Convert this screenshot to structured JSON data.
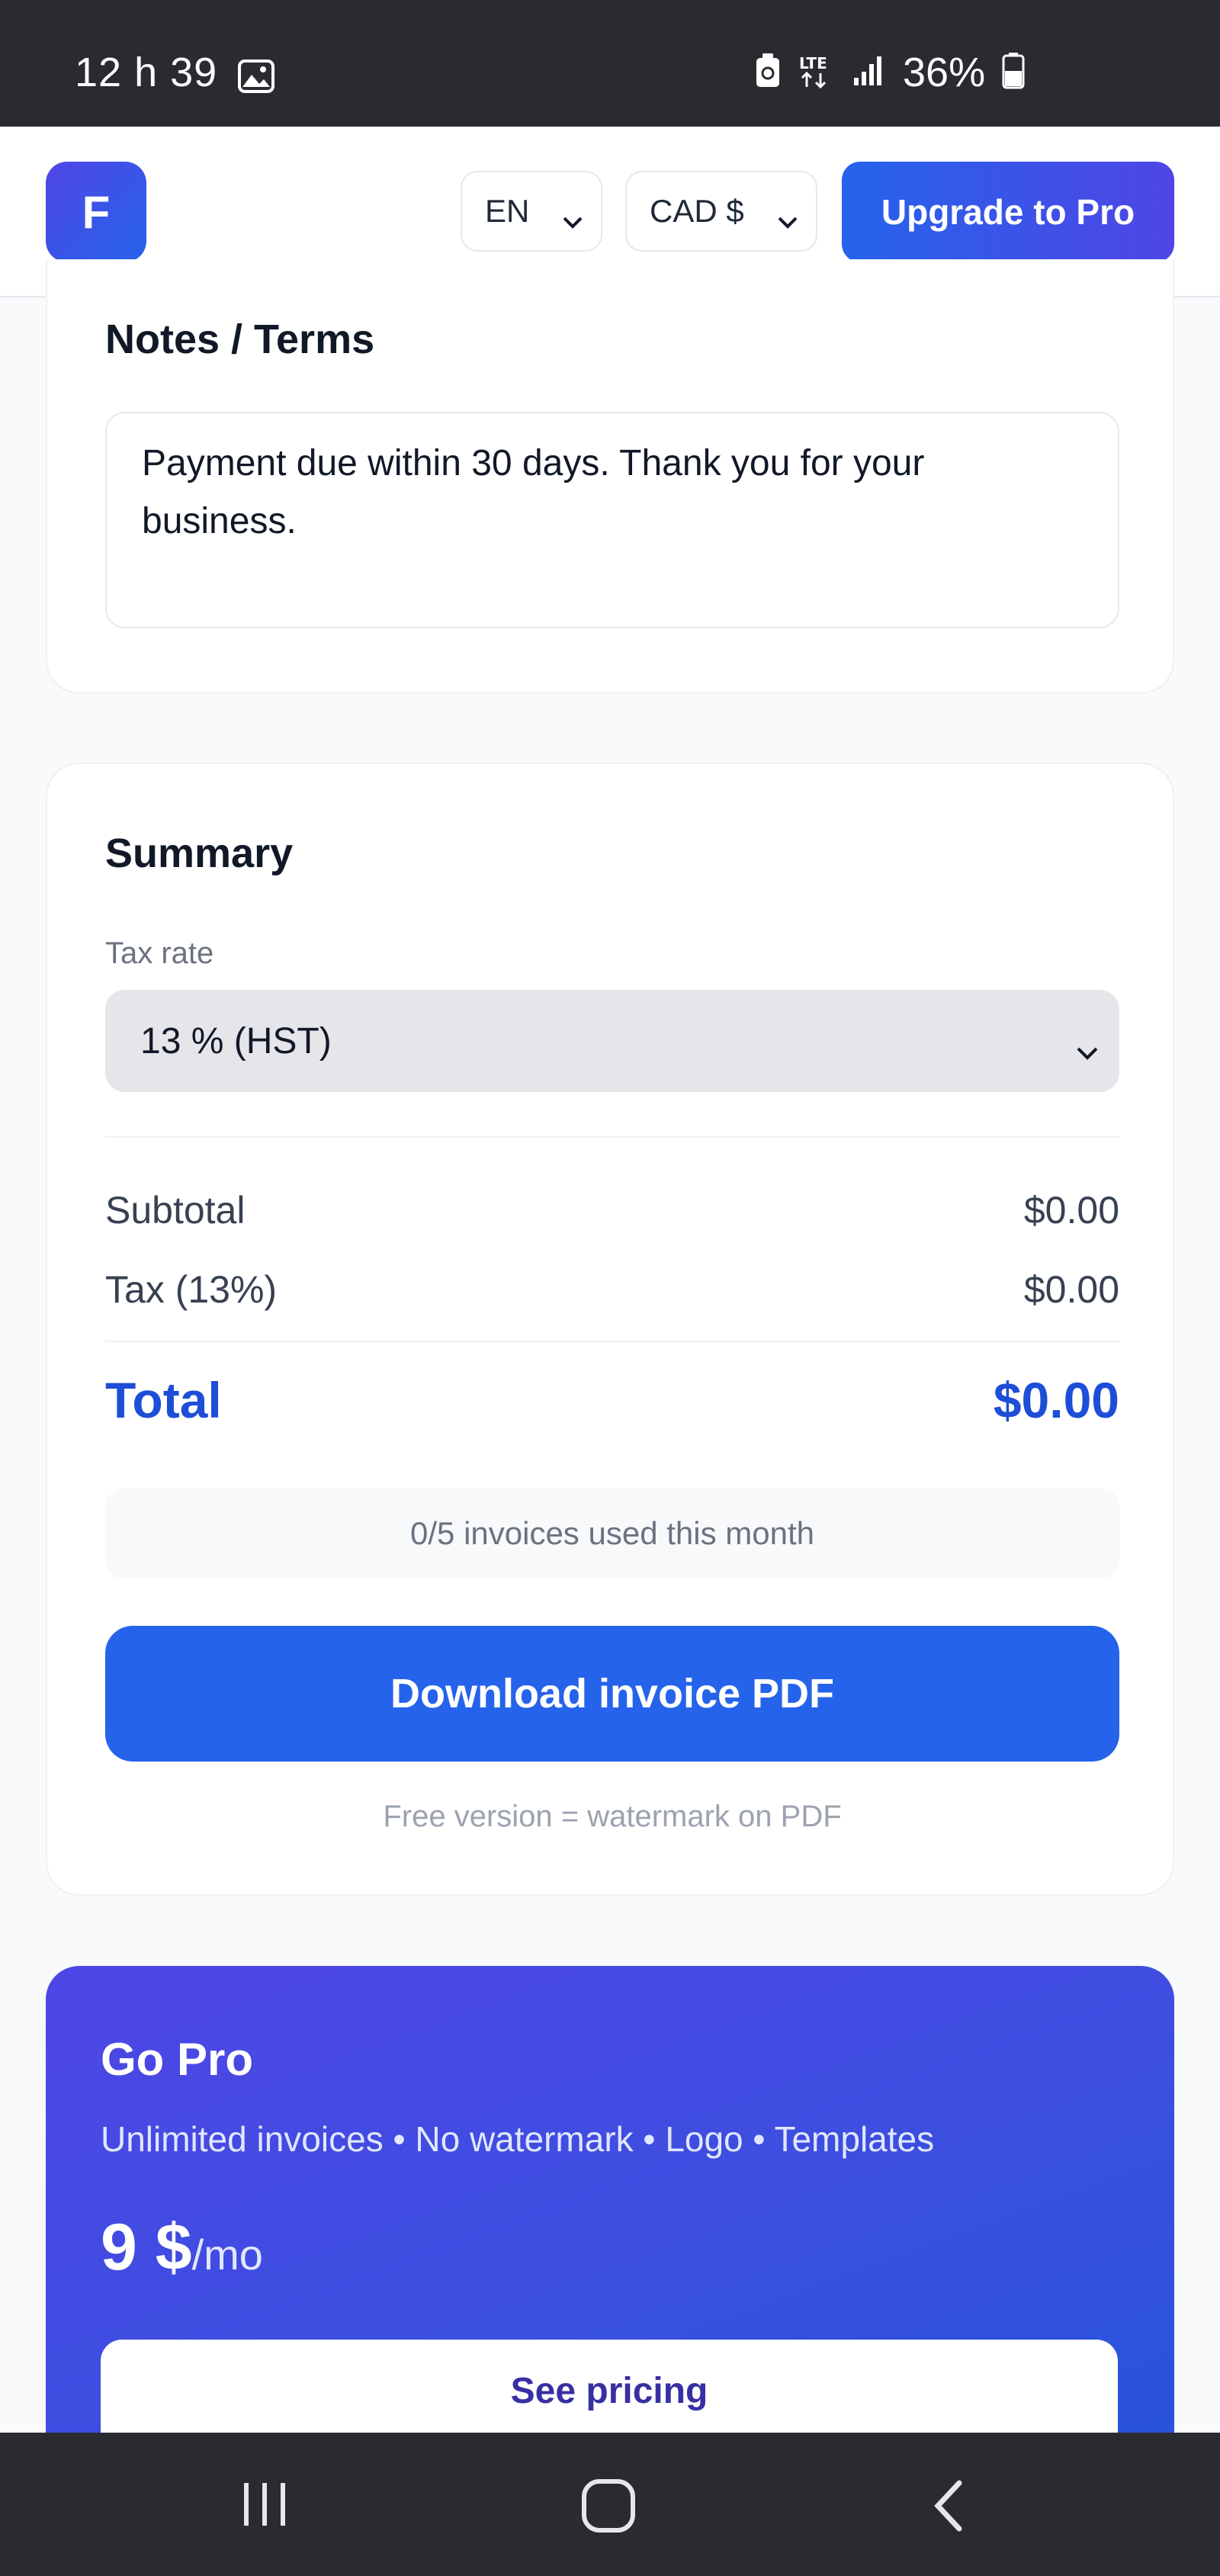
{
  "status_bar": {
    "time": "12 h 39",
    "battery_percent": "36%",
    "network": "LTE",
    "icons": [
      "image-icon",
      "recycle-icon",
      "lte-icon",
      "signal-icon",
      "battery-icon"
    ]
  },
  "header": {
    "logo_letter": "F",
    "language": "EN",
    "currency": "CAD $",
    "upgrade_label": "Upgrade to Pro"
  },
  "notes": {
    "title": "Notes / Terms",
    "value": "Payment due within 30 days. Thank you for your business."
  },
  "summary": {
    "title": "Summary",
    "tax_rate_label": "Tax rate",
    "tax_rate_value": "13 % (HST)",
    "subtotal_label": "Subtotal",
    "subtotal_value": "$0.00",
    "tax_label": "Tax (13%)",
    "tax_value": "$0.00",
    "total_label": "Total",
    "total_value": "$0.00",
    "usage_text": "0/5 invoices used this month",
    "download_label": "Download invoice PDF",
    "watermark_note": "Free version = watermark on PDF"
  },
  "pro": {
    "title": "Go Pro",
    "features": "Unlimited invoices • No watermark • Logo • Templates",
    "price": "9 $",
    "price_unit": "/mo",
    "cta_label": "See pricing"
  },
  "colors": {
    "primary": "#2563eb",
    "accent": "#4f46e5",
    "total_text": "#1d4ed8",
    "system_bar": "#2a2b30"
  }
}
